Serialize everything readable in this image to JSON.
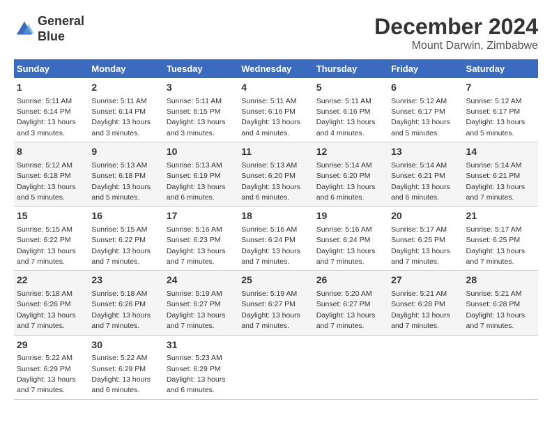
{
  "header": {
    "logo_line1": "General",
    "logo_line2": "Blue",
    "month_title": "December 2024",
    "location": "Mount Darwin, Zimbabwe"
  },
  "days_of_week": [
    "Sunday",
    "Monday",
    "Tuesday",
    "Wednesday",
    "Thursday",
    "Friday",
    "Saturday"
  ],
  "weeks": [
    [
      {
        "num": "1",
        "rise": "5:11 AM",
        "set": "6:14 PM",
        "daylight": "13 hours and 3 minutes."
      },
      {
        "num": "2",
        "rise": "5:11 AM",
        "set": "6:14 PM",
        "daylight": "13 hours and 3 minutes."
      },
      {
        "num": "3",
        "rise": "5:11 AM",
        "set": "6:15 PM",
        "daylight": "13 hours and 3 minutes."
      },
      {
        "num": "4",
        "rise": "5:11 AM",
        "set": "6:16 PM",
        "daylight": "13 hours and 4 minutes."
      },
      {
        "num": "5",
        "rise": "5:11 AM",
        "set": "6:16 PM",
        "daylight": "13 hours and 4 minutes."
      },
      {
        "num": "6",
        "rise": "5:12 AM",
        "set": "6:17 PM",
        "daylight": "13 hours and 5 minutes."
      },
      {
        "num": "7",
        "rise": "5:12 AM",
        "set": "6:17 PM",
        "daylight": "13 hours and 5 minutes."
      }
    ],
    [
      {
        "num": "8",
        "rise": "5:12 AM",
        "set": "6:18 PM",
        "daylight": "13 hours and 5 minutes."
      },
      {
        "num": "9",
        "rise": "5:13 AM",
        "set": "6:18 PM",
        "daylight": "13 hours and 5 minutes."
      },
      {
        "num": "10",
        "rise": "5:13 AM",
        "set": "6:19 PM",
        "daylight": "13 hours and 6 minutes."
      },
      {
        "num": "11",
        "rise": "5:13 AM",
        "set": "6:20 PM",
        "daylight": "13 hours and 6 minutes."
      },
      {
        "num": "12",
        "rise": "5:14 AM",
        "set": "6:20 PM",
        "daylight": "13 hours and 6 minutes."
      },
      {
        "num": "13",
        "rise": "5:14 AM",
        "set": "6:21 PM",
        "daylight": "13 hours and 6 minutes."
      },
      {
        "num": "14",
        "rise": "5:14 AM",
        "set": "6:21 PM",
        "daylight": "13 hours and 7 minutes."
      }
    ],
    [
      {
        "num": "15",
        "rise": "5:15 AM",
        "set": "6:22 PM",
        "daylight": "13 hours and 7 minutes."
      },
      {
        "num": "16",
        "rise": "5:15 AM",
        "set": "6:22 PM",
        "daylight": "13 hours and 7 minutes."
      },
      {
        "num": "17",
        "rise": "5:16 AM",
        "set": "6:23 PM",
        "daylight": "13 hours and 7 minutes."
      },
      {
        "num": "18",
        "rise": "5:16 AM",
        "set": "6:24 PM",
        "daylight": "13 hours and 7 minutes."
      },
      {
        "num": "19",
        "rise": "5:16 AM",
        "set": "6:24 PM",
        "daylight": "13 hours and 7 minutes."
      },
      {
        "num": "20",
        "rise": "5:17 AM",
        "set": "6:25 PM",
        "daylight": "13 hours and 7 minutes."
      },
      {
        "num": "21",
        "rise": "5:17 AM",
        "set": "6:25 PM",
        "daylight": "13 hours and 7 minutes."
      }
    ],
    [
      {
        "num": "22",
        "rise": "5:18 AM",
        "set": "6:26 PM",
        "daylight": "13 hours and 7 minutes."
      },
      {
        "num": "23",
        "rise": "5:18 AM",
        "set": "6:26 PM",
        "daylight": "13 hours and 7 minutes."
      },
      {
        "num": "24",
        "rise": "5:19 AM",
        "set": "6:27 PM",
        "daylight": "13 hours and 7 minutes."
      },
      {
        "num": "25",
        "rise": "5:19 AM",
        "set": "6:27 PM",
        "daylight": "13 hours and 7 minutes."
      },
      {
        "num": "26",
        "rise": "5:20 AM",
        "set": "6:27 PM",
        "daylight": "13 hours and 7 minutes."
      },
      {
        "num": "27",
        "rise": "5:21 AM",
        "set": "6:28 PM",
        "daylight": "13 hours and 7 minutes."
      },
      {
        "num": "28",
        "rise": "5:21 AM",
        "set": "6:28 PM",
        "daylight": "13 hours and 7 minutes."
      }
    ],
    [
      {
        "num": "29",
        "rise": "5:22 AM",
        "set": "6:29 PM",
        "daylight": "13 hours and 7 minutes."
      },
      {
        "num": "30",
        "rise": "5:22 AM",
        "set": "6:29 PM",
        "daylight": "13 hours and 6 minutes."
      },
      {
        "num": "31",
        "rise": "5:23 AM",
        "set": "6:29 PM",
        "daylight": "13 hours and 6 minutes."
      },
      null,
      null,
      null,
      null
    ]
  ]
}
